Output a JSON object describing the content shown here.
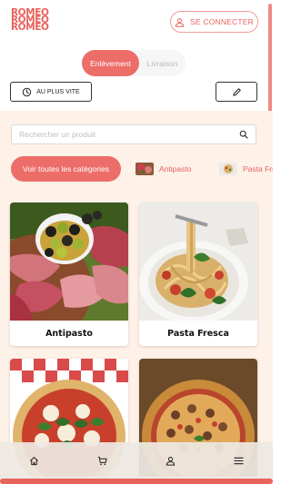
{
  "brand": {
    "logo_lines": [
      "ROMEO",
      "ROMEO",
      "ROMEO"
    ],
    "accent": "#e8625e"
  },
  "header": {
    "login_label": "SE CONNECTER",
    "login_icon": "user-icon"
  },
  "order_mode": {
    "options": [
      "Enlèvement",
      "Livraison"
    ],
    "selected": "Enlèvement"
  },
  "timing": {
    "label": "AU PLUS VITE",
    "icon": "clock-icon"
  },
  "edit": {
    "icon": "pencil-icon"
  },
  "search": {
    "placeholder": "Rechercher un produit",
    "value": "",
    "icon": "search-icon"
  },
  "categories": {
    "all_label": "Voir toutes les catégories",
    "items": [
      {
        "label": "Antipasto"
      },
      {
        "label": "Pasta Fresca"
      }
    ]
  },
  "products": [
    {
      "name": "Antipasto"
    },
    {
      "name": "Pasta Fresca"
    },
    {
      "name": ""
    },
    {
      "name": ""
    }
  ],
  "bottom_nav": [
    {
      "icon": "home-icon"
    },
    {
      "icon": "cart-icon"
    },
    {
      "icon": "account-icon"
    },
    {
      "icon": "menu-icon"
    }
  ]
}
